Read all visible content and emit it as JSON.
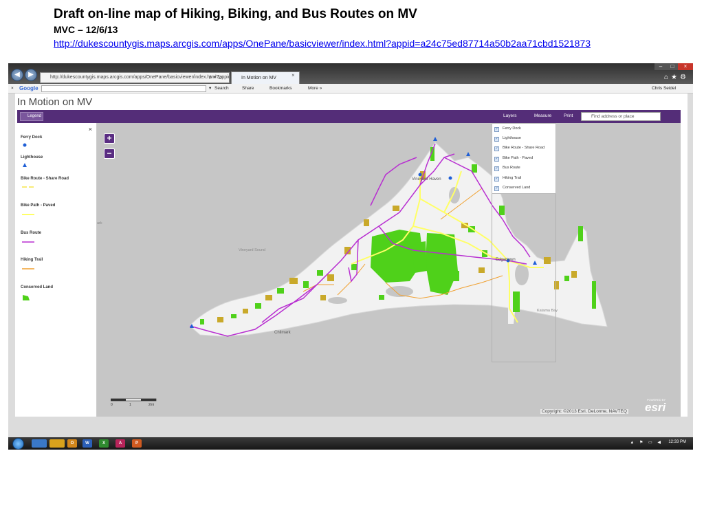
{
  "slide": {
    "title": "Draft on-line map of Hiking, Biking, and Bus Routes on MV",
    "subtitle": "MVC – 12/6/13",
    "link": "http://dukescountygis.maps.arcgis.com/apps/OnePane/basicviewer/index.html?appid=a24c75ed87714a50b2aa71cbd1521873"
  },
  "browser": {
    "address": "http://dukescountygis.maps.arcgis.com/apps/OnePane/basicviewer/index.html?appid=",
    "tab_title": "In Motion on MV",
    "toolbar": {
      "close": "×",
      "google": "Google",
      "search": "Search",
      "share": "Share",
      "bookmarks": "Bookmarks",
      "more": "More »",
      "user": "Chris Seidel"
    }
  },
  "app": {
    "title": "In Motion on MV",
    "legend_button": "Legend",
    "layers_button": "Layers",
    "measure_button": "Measure",
    "print_button": "Print",
    "find_placeholder": "Find address or place"
  },
  "legend": {
    "close": "×",
    "items": [
      {
        "label": "Ferry Dock",
        "color": "#1f5fd6"
      },
      {
        "label": "Lighthouse",
        "color": "#1f5fd6"
      },
      {
        "label": "Bike Route - Share Road",
        "color": "#f7e64a"
      },
      {
        "label": "Bike Path - Paved",
        "color": "#ffff66"
      },
      {
        "label": "Bus Route",
        "color": "#b82fd1"
      },
      {
        "label": "Hiking Trail",
        "color": "#f0a030"
      },
      {
        "label": "Conserved Land",
        "color": "#4fd11a"
      }
    ]
  },
  "layers": [
    "Ferry Dock",
    "Lighthouse",
    "Bike Route - Share Road",
    "Bike Path - Paved",
    "Bus Route",
    "Hiking Trail",
    "Conserved Land"
  ],
  "map": {
    "zoom_in": "+",
    "zoom_out": "−",
    "labels": {
      "vineyard_haven": "Vineyard Haven",
      "edgartown": "Edgartown",
      "chilmark": "Chilmark",
      "vineyard_sound": "Vineyard Sound",
      "katama_bay": "Katama Bay",
      "edge": "ark"
    },
    "scale": {
      "t0": "0",
      "t1": "1",
      "t2": "2mi"
    },
    "copyright": "Copyright: ©2013 Esri, DeLorme, NAVTEQ",
    "esri": "esri",
    "powered": "POWERED BY"
  },
  "taskbar": {
    "clock": "12:33 PM",
    "apps": [
      {
        "label": "",
        "color": "#3a78c8"
      },
      {
        "label": "",
        "color": "#d9a21c"
      },
      {
        "label": "O",
        "color": "#d2861b"
      },
      {
        "label": "W",
        "color": "#2b5fb8"
      },
      {
        "label": "X",
        "color": "#2f8a2f"
      },
      {
        "label": "A",
        "color": "#b8245a"
      },
      {
        "label": "P",
        "color": "#d05a20"
      }
    ]
  }
}
